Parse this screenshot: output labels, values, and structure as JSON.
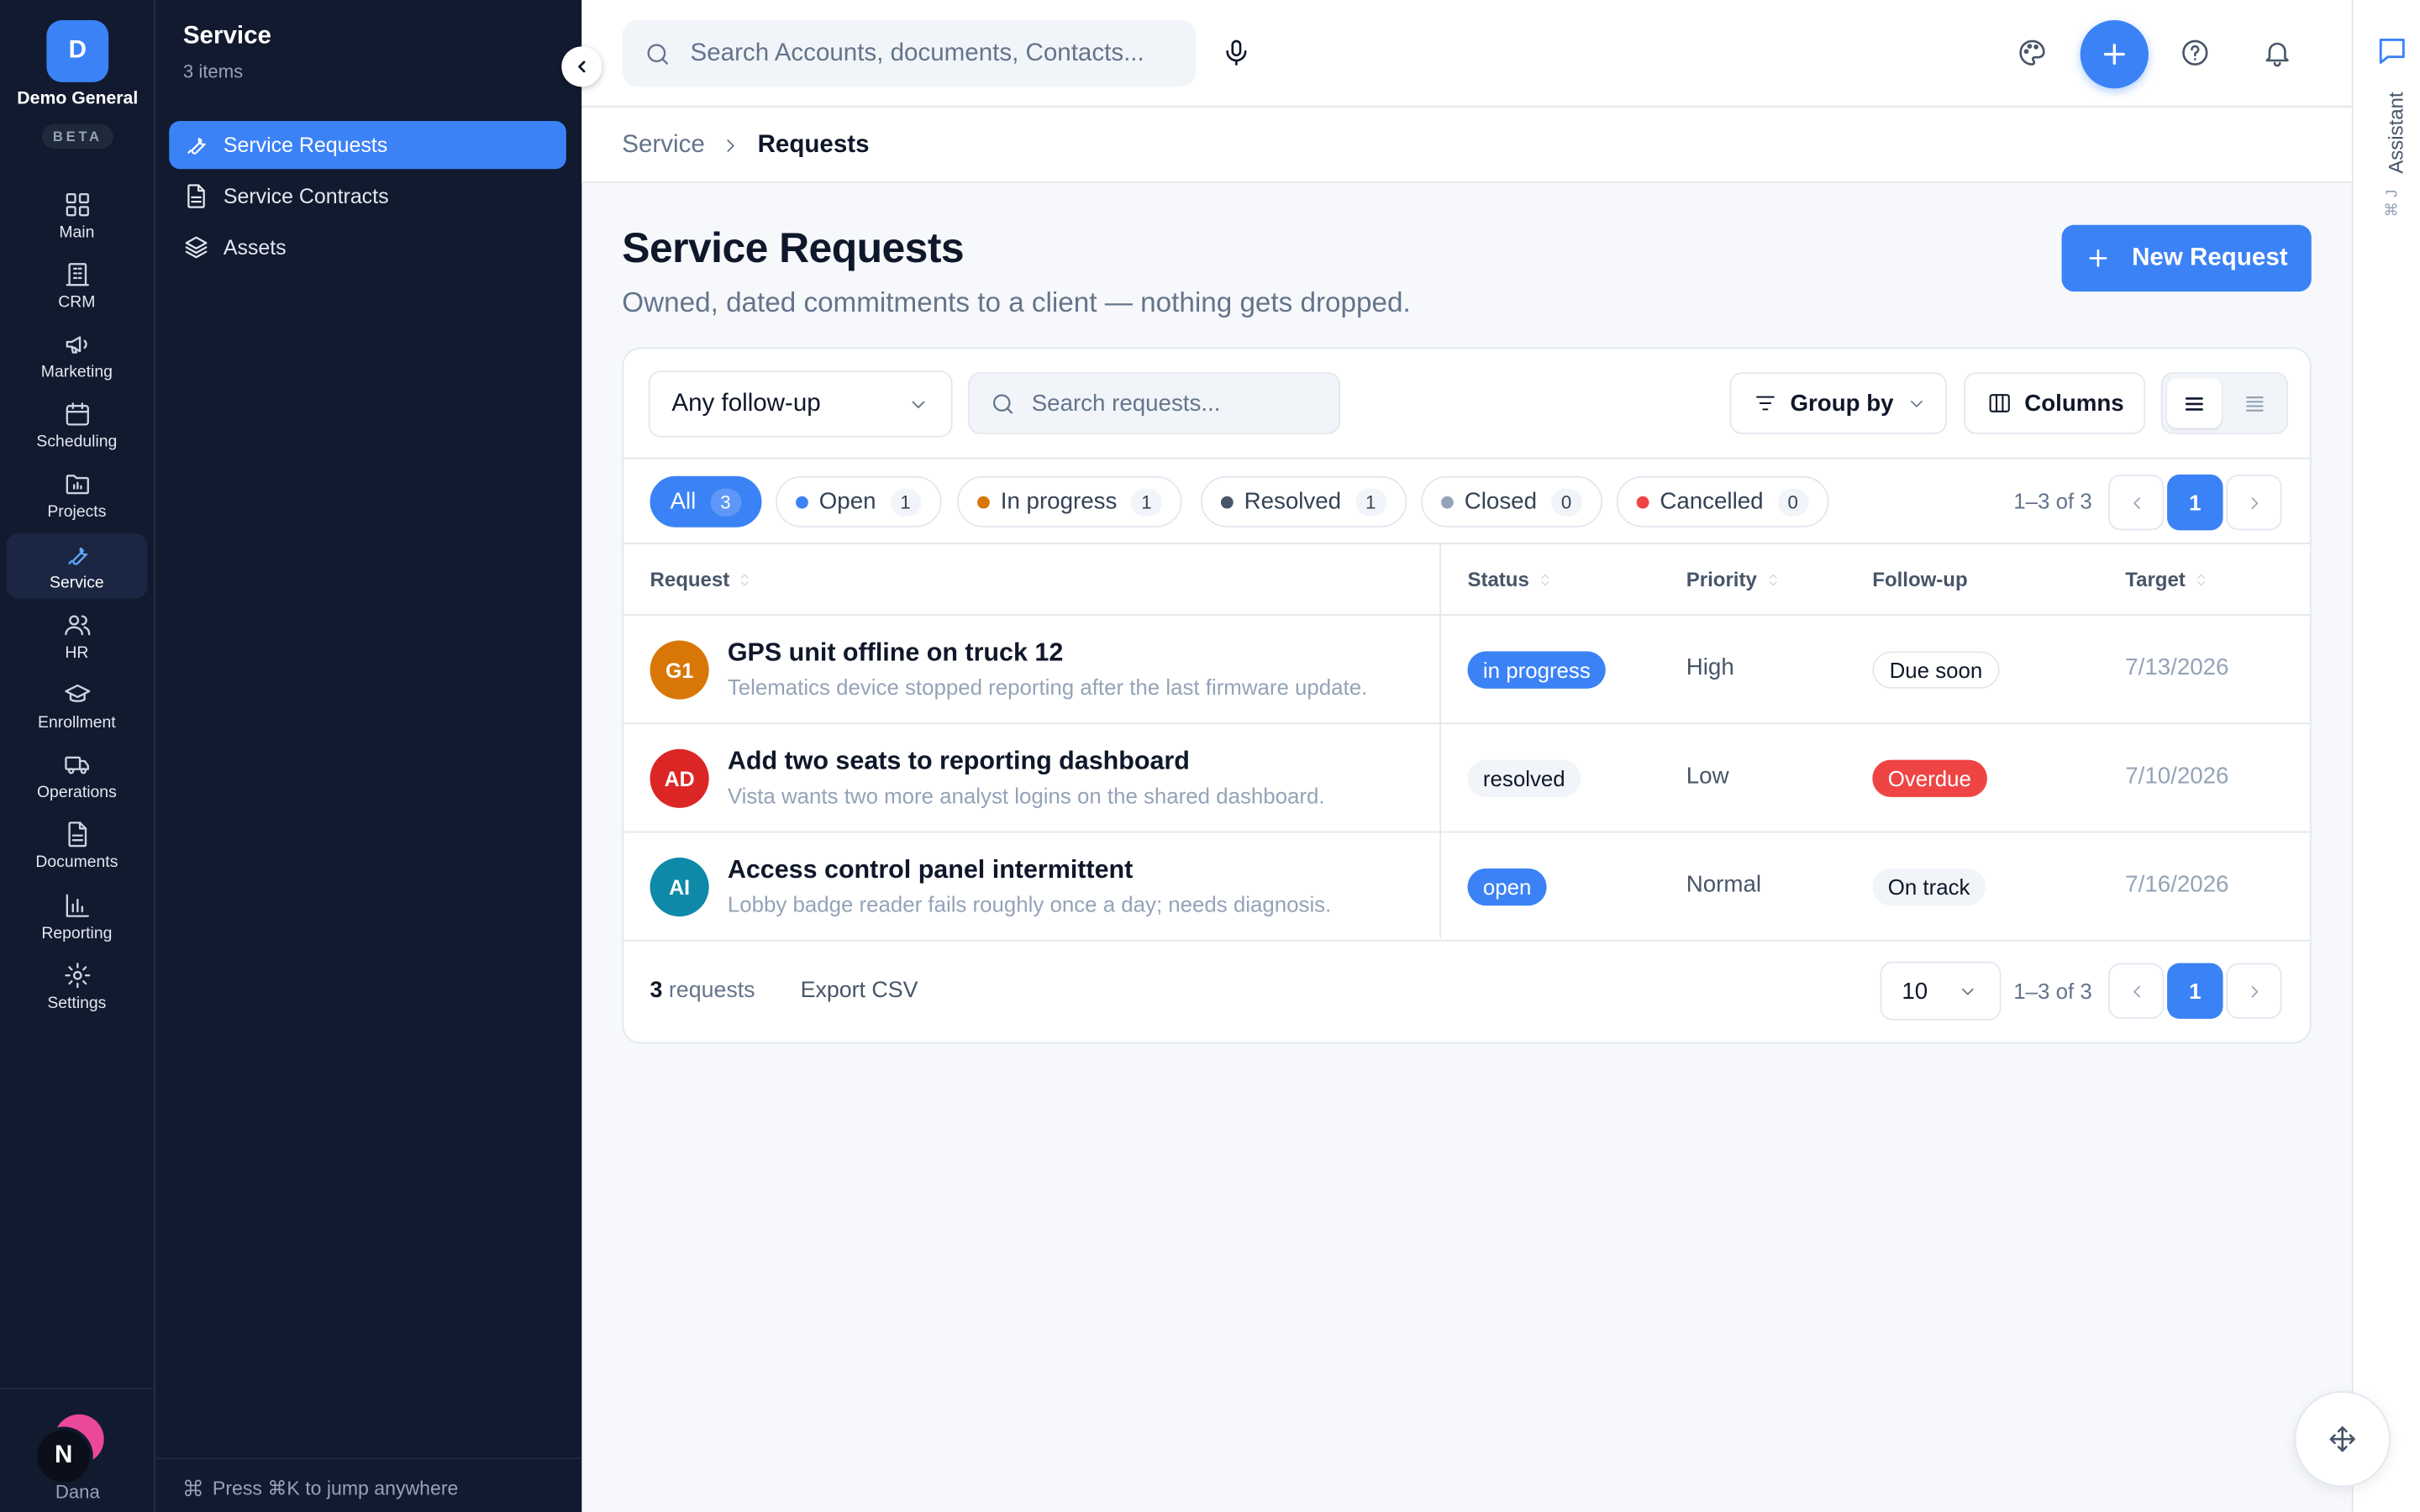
{
  "org": {
    "initial": "D",
    "name": "Demo General",
    "badge": "BETA"
  },
  "rail": [
    {
      "label": "Main",
      "icon": "grid-icon"
    },
    {
      "label": "CRM",
      "icon": "building-icon"
    },
    {
      "label": "Marketing",
      "icon": "megaphone-icon"
    },
    {
      "label": "Scheduling",
      "icon": "calendar-icon"
    },
    {
      "label": "Projects",
      "icon": "folder-chart-icon"
    },
    {
      "label": "Service",
      "icon": "wrench-icon",
      "active": true
    },
    {
      "label": "HR",
      "icon": "users-icon"
    },
    {
      "label": "Enrollment",
      "icon": "graduation-cap-icon"
    },
    {
      "label": "Operations",
      "icon": "truck-icon"
    },
    {
      "label": "Documents",
      "icon": "file-icon"
    },
    {
      "label": "Reporting",
      "icon": "bar-chart-icon"
    },
    {
      "label": "Settings",
      "icon": "gear-icon"
    }
  ],
  "user": {
    "initial": "N",
    "name": "Dana"
  },
  "subnav": {
    "title": "Service",
    "count": "3 items",
    "items": [
      {
        "label": "Service Requests",
        "icon": "wrench-icon",
        "active": true
      },
      {
        "label": "Service Contracts",
        "icon": "document-icon"
      },
      {
        "label": "Assets",
        "icon": "layers-icon"
      }
    ],
    "hint": "Press ⌘K to jump anywhere"
  },
  "topbar": {
    "search_placeholder": "Search Accounts, documents, Contacts..."
  },
  "assistant": {
    "label": "Assistant",
    "shortcut": "⌘ J"
  },
  "breadcrumb": {
    "parent": "Service",
    "current": "Requests"
  },
  "page": {
    "title": "Service Requests",
    "subtitle": "Owned, dated commitments to a client — nothing gets dropped.",
    "new_button": "New Request"
  },
  "toolbar": {
    "followup_value": "Any follow-up",
    "search_placeholder": "Search requests...",
    "group_by": "Group by",
    "columns": "Columns"
  },
  "filters": [
    {
      "label": "All",
      "count": "3",
      "active": true
    },
    {
      "label": "Open",
      "count": "1",
      "color": "#3b82f6"
    },
    {
      "label": "In progress",
      "count": "1",
      "color": "#d97706"
    },
    {
      "label": "Resolved",
      "count": "1",
      "color": "#475569"
    },
    {
      "label": "Closed",
      "count": "0",
      "color": "#94a3b8"
    },
    {
      "label": "Cancelled",
      "count": "0",
      "color": "#ef4444"
    }
  ],
  "pagination": {
    "range": "1–3 of 3",
    "page": "1"
  },
  "table": {
    "headers": [
      "Request",
      "Status",
      "Priority",
      "Follow-up",
      "Target"
    ],
    "rows": [
      {
        "initials": "G1",
        "avatar_color": "#d97706",
        "title": "GPS unit offline on truck 12",
        "desc": "Telematics device stopped reporting after the last firmware update.",
        "status": "in progress",
        "priority": "High",
        "followup": "Due soon",
        "target": "7/13/2026"
      },
      {
        "initials": "AD",
        "avatar_color": "#dc2626",
        "title": "Add two seats to reporting dashboard",
        "desc": "Vista wants two more analyst logins on the shared dashboard.",
        "status": "resolved",
        "priority": "Low",
        "followup": "Overdue",
        "target": "7/10/2026"
      },
      {
        "initials": "AI",
        "avatar_color": "#0e8aa8",
        "title": "Access control panel intermittent",
        "desc": "Lobby badge reader fails roughly once a day; needs diagnosis.",
        "status": "open",
        "priority": "Normal",
        "followup": "On track",
        "target": "7/16/2026"
      }
    ]
  },
  "footer": {
    "count": "3",
    "count_label": "requests",
    "export": "Export CSV",
    "page_size": "10"
  }
}
